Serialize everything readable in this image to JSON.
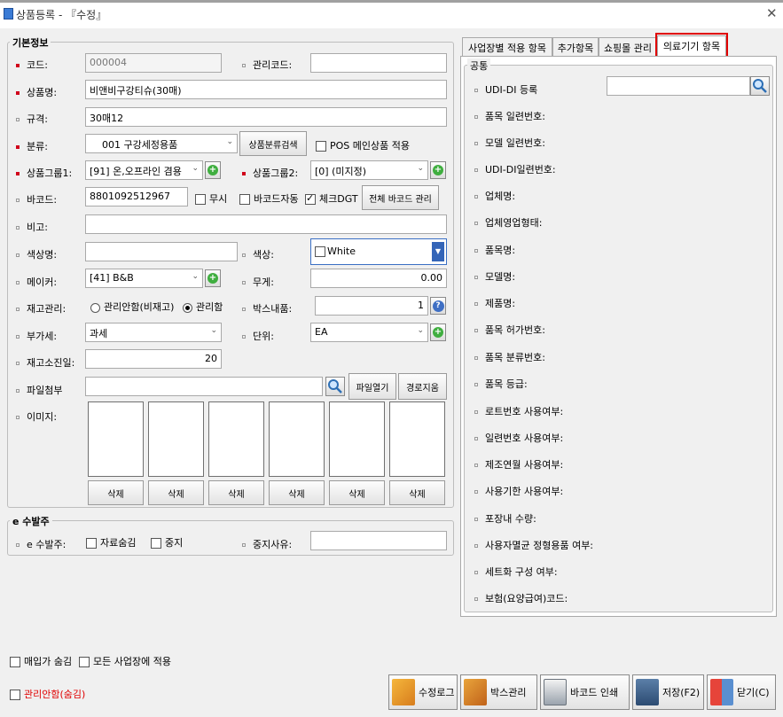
{
  "window": {
    "title": "상품등록 - 『수정』"
  },
  "basic": {
    "title": "기본정보",
    "code_label": "코드:",
    "code_value": "000004",
    "mgmt_code_label": "관리코드:",
    "mgmt_code_value": "",
    "name_label": "상품명:",
    "name_value": "비앤비구강티슈(30매)",
    "spec_label": "규격:",
    "spec_value": "30매12",
    "category_label": "분류:",
    "category_value": "001 구강세정용품",
    "category_search": "상품분류검색",
    "pos_menu": "POS 메인상품 적용",
    "group1_label": "상품그룹1:",
    "group1_value": "[91] 온,오프라인 겸용",
    "group2_label": "상품그룹2:",
    "group2_value": "[0] (미지정)",
    "barcode_label": "바코드:",
    "barcode_value": "8801092512967",
    "ignore": "무시",
    "auto_barcode": "바코드자동",
    "check_dgt": "체크DGT",
    "all_barcode": "전체 바코드 관리",
    "note_label": "비고:",
    "note_value": "",
    "color_name_label": "색상명:",
    "color_name_value": "",
    "color_label": "색상:",
    "color_value": "White",
    "maker_label": "메이커:",
    "maker_value": "[41] B&B",
    "weight_label": "무게:",
    "weight_value": "0.00",
    "stock_label": "재고관리:",
    "stock_off": "관리안함(비재고)",
    "stock_on": "관리함",
    "box_label": "박스내품:",
    "box_value": "1",
    "vat_label": "부가세:",
    "vat_value": "과세",
    "unit_label": "단위:",
    "unit_value": "EA",
    "stock_days_label": "재고소진일:",
    "stock_days_value": "20",
    "file_label": "파일첨부",
    "file_value": "",
    "file_open": "파일열기",
    "path_clear": "경로지움",
    "image_label": "이미지:",
    "delete_labels": [
      "삭제",
      "삭제",
      "삭제",
      "삭제",
      "삭제",
      "삭제"
    ]
  },
  "eorder": {
    "title": "e 수발주",
    "label": "e 수발주:",
    "hide_data": "자료숨김",
    "stop": "중지",
    "stop_reason_label": "중지사유:",
    "stop_reason_value": ""
  },
  "bottom": {
    "hide_purchase": "매입가 숨김",
    "apply_all": "모든 사업장에 적용",
    "hide_unmanaged": "관리안함(숨김)",
    "buttons": [
      "수정로그",
      "박스관리",
      "바코드 인쇄",
      "저장(F2)",
      "닫기(C)"
    ]
  },
  "tabs": [
    "사업장별 적용 항목",
    "추가항목",
    "쇼핑몰 관리",
    "의료기기 항목"
  ],
  "medical": {
    "title": "공통",
    "fields": [
      "UDI-DI 등록",
      "품목 일련번호:",
      "모델 일련번호:",
      "UDI-DI일련번호:",
      "업체명:",
      "업체영업형태:",
      "품목명:",
      "모델명:",
      "제품명:",
      "품목 허가번호:",
      "품목 분류번호:",
      "품목 등급:",
      "로트번호 사용여부:",
      "일련번호 사용여부:",
      "제조연월 사용여부:",
      "사용기한 사용여부:",
      "포장내 수량:",
      "사용자멸균 정형용품 여부:",
      "세트화 구성 여부:",
      "보험(요양급여)코드:"
    ]
  },
  "colors": {
    "accent_red": "#e00000",
    "required_bullet": "#d0021b"
  }
}
